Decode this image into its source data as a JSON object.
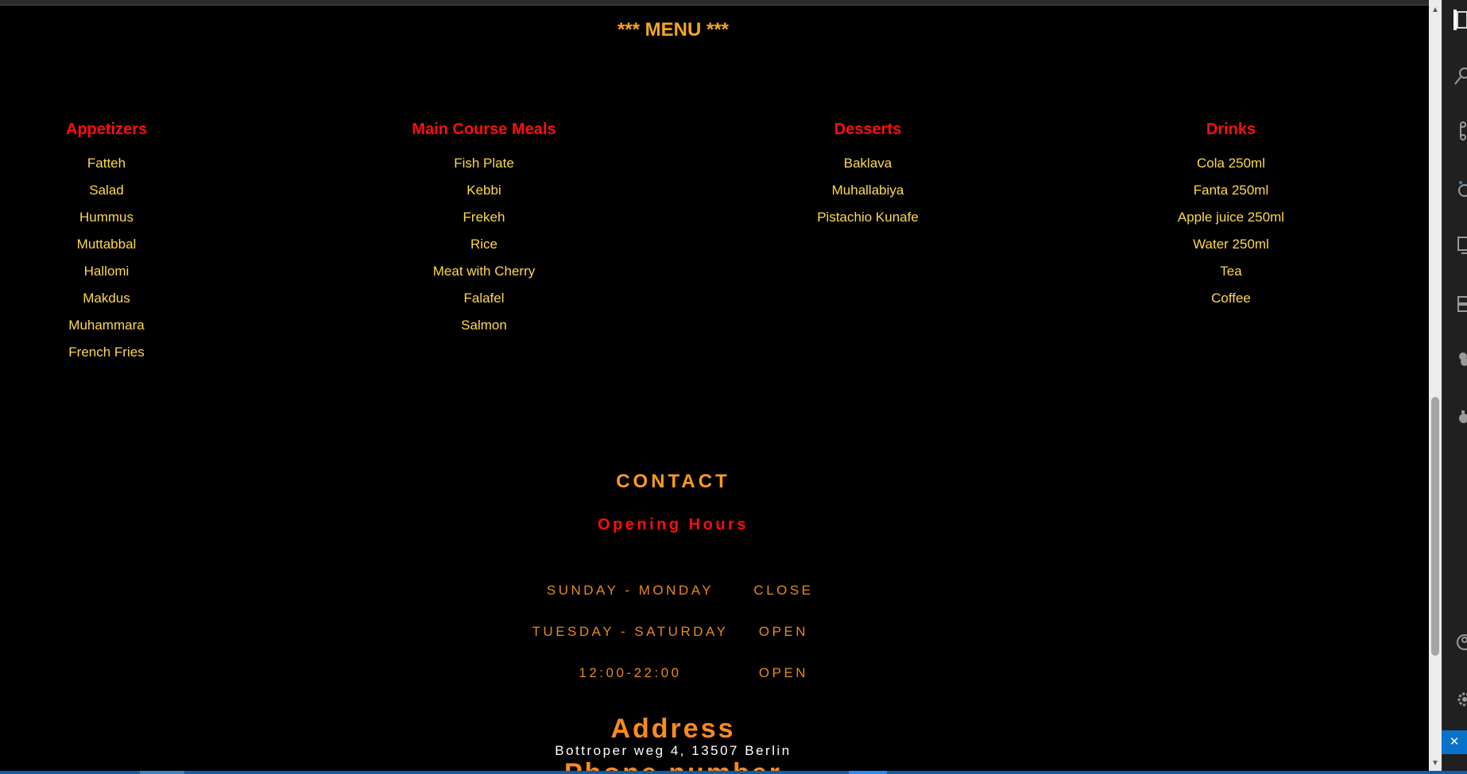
{
  "menu": {
    "title": "*** MENU ***",
    "categories": [
      {
        "heading": "Appetizers",
        "items": [
          "Fatteh",
          "Salad",
          "Hummus",
          "Muttabbal",
          "Hallomi",
          "Makdus",
          "Muhammara",
          "French Fries"
        ]
      },
      {
        "heading": "Main Course Meals",
        "items": [
          "Fish Plate",
          "Kebbi",
          "Frekeh",
          "Rice",
          "Meat with Cherry",
          "Falafel",
          "Salmon"
        ]
      },
      {
        "heading": "Desserts",
        "items": [
          "Baklava",
          "Muhallabiya",
          "Pistachio Kunafe"
        ]
      },
      {
        "heading": "Drinks",
        "items": [
          "Cola 250ml",
          "Fanta 250ml",
          "Apple juice 250ml",
          "Water 250ml",
          "Tea",
          "Coffee"
        ]
      }
    ]
  },
  "contact": {
    "title": "CONTACT",
    "opening_hours_title": "Opening Hours",
    "hours": [
      {
        "day": "SUNDAY - MONDAY",
        "status": "CLOSE"
      },
      {
        "day": "TUESDAY - SATURDAY",
        "status": "OPEN"
      },
      {
        "day": "12:00-22:00",
        "status": "OPEN"
      }
    ],
    "address_title": "Address",
    "address": "Bottroper weg 4, 13507 Berlin",
    "phone_title": "Phone number"
  },
  "colors": {
    "background": "#000000",
    "menu_title": "#f5a623",
    "category_heading": "#ff0d0d",
    "menu_item": "#ffd84a",
    "contact_text": "#e8891c",
    "editor_accent": "#0a72c9"
  },
  "icons": {
    "activity_bar": [
      "explorer-icon",
      "search-icon",
      "source-control-icon",
      "run-debug-icon",
      "remote-explorer-icon",
      "extensions-icon",
      "database-icon",
      "docker-icon",
      "account-icon",
      "settings-gear-icon"
    ],
    "remote": "remote-window-icon"
  }
}
